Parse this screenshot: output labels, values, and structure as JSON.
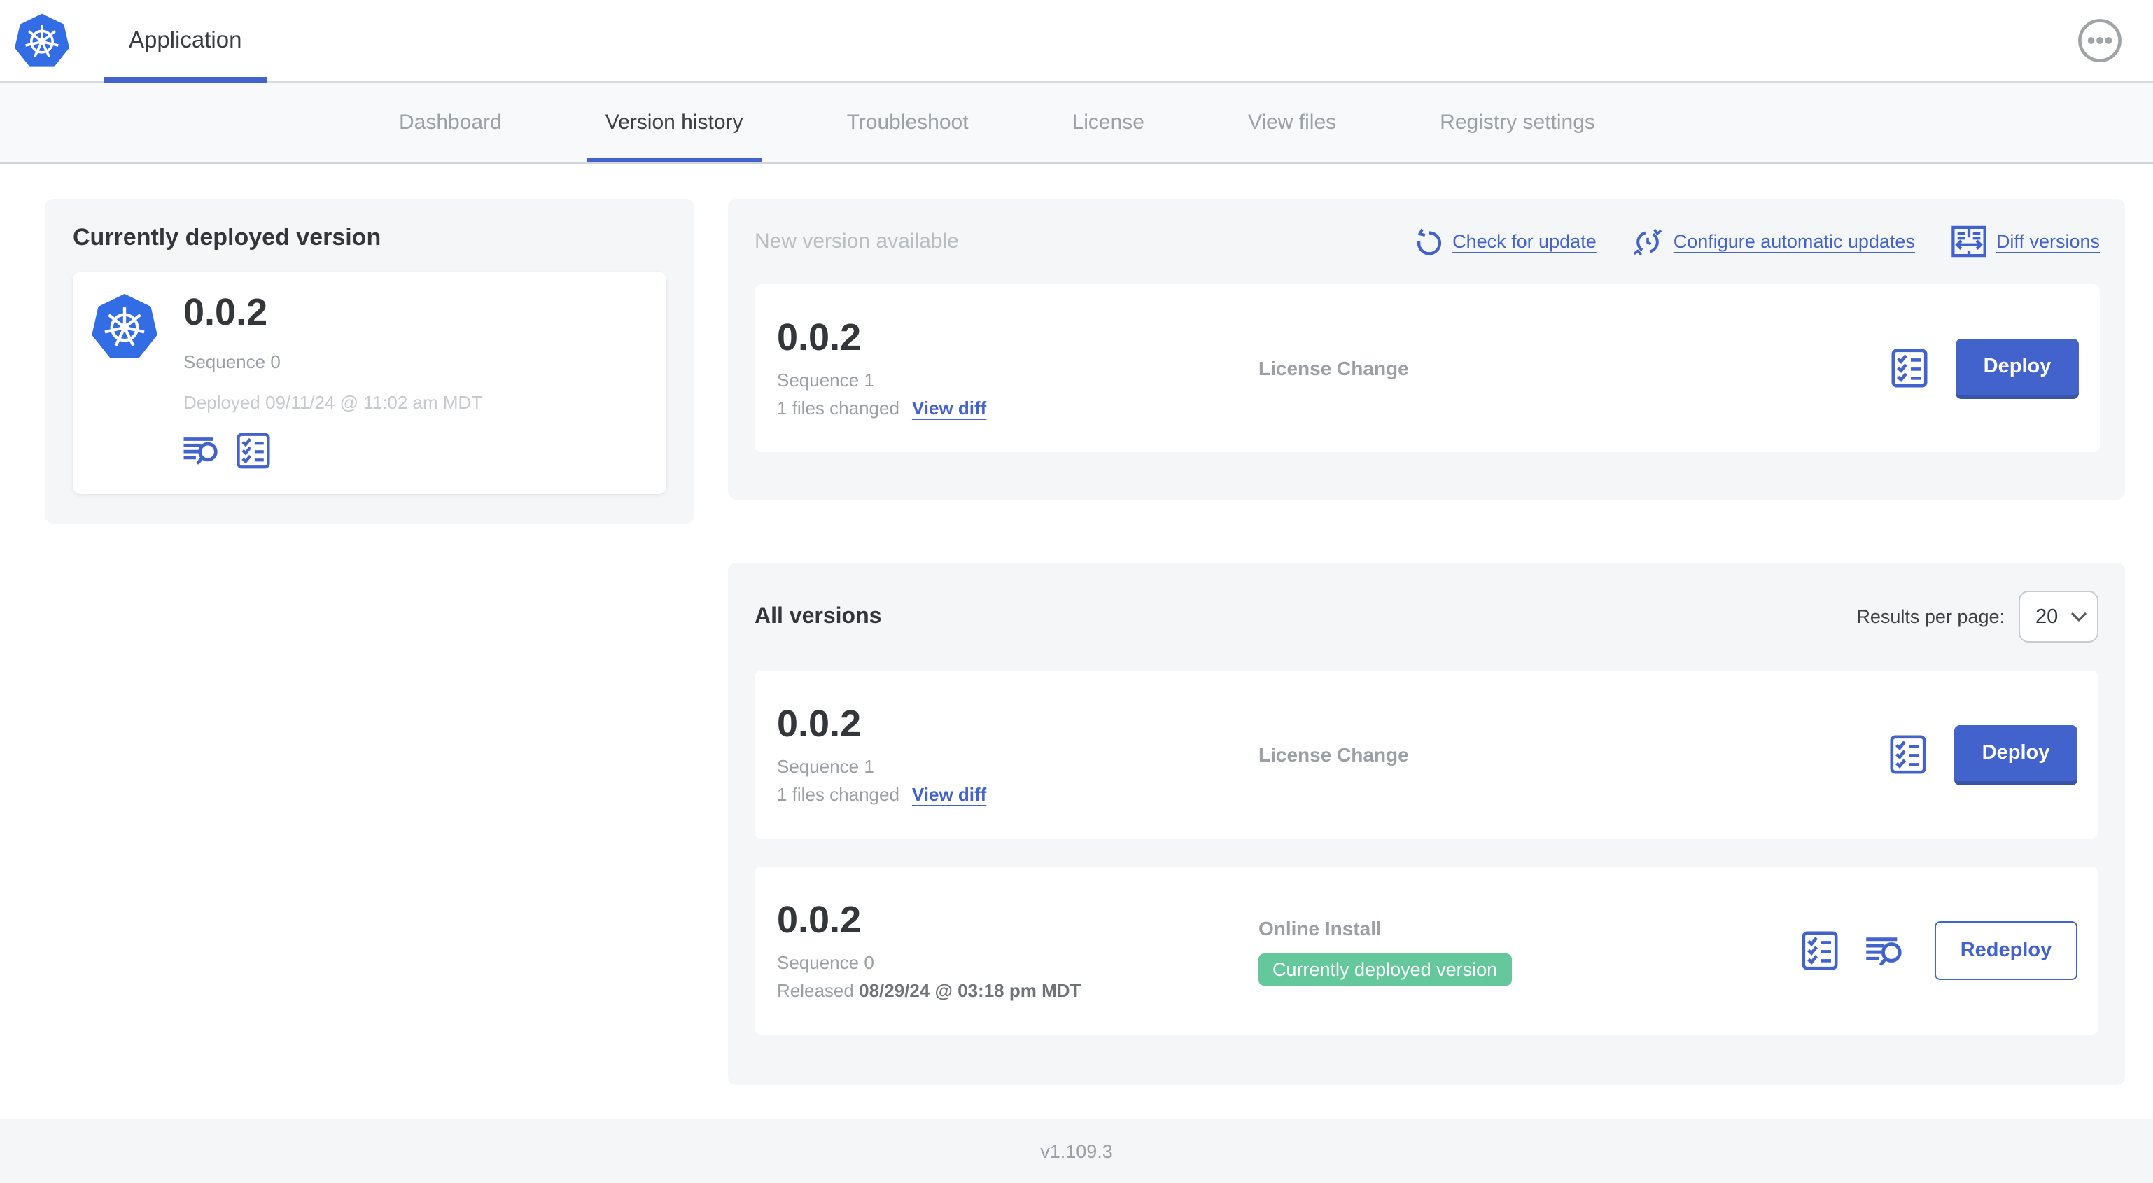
{
  "colors": {
    "accent": "#4263cb",
    "badge_green": "#65c89c",
    "k8s_blue": "#326de6"
  },
  "header": {
    "app_tab_label": "Application"
  },
  "nav": {
    "tabs": [
      "Dashboard",
      "Version history",
      "Troubleshoot",
      "License",
      "View files",
      "Registry settings"
    ],
    "active_tab": "Version history"
  },
  "deployed_panel": {
    "title": "Currently deployed version",
    "version": "0.0.2",
    "sequence": "Sequence 0",
    "deployed": "Deployed 09/11/24 @ 11:02 am MDT"
  },
  "new_version_panel": {
    "title": "New version available",
    "check_link": "Check for update",
    "configure_link": "Configure automatic updates",
    "diff_link": "Diff versions",
    "card": {
      "version": "0.0.2",
      "sequence": "Sequence 1",
      "files_changed": "1 files changed",
      "view_diff": "View diff",
      "source": "License Change",
      "deploy_button": "Deploy"
    }
  },
  "all_versions_panel": {
    "title": "All versions",
    "results_label": "Results per page:",
    "results_value": "20",
    "rows": [
      {
        "version": "0.0.2",
        "sequence": "Sequence 1",
        "files_changed": "1 files changed",
        "view_diff": "View diff",
        "source": "License Change",
        "action_button": "Deploy"
      },
      {
        "version": "0.0.2",
        "sequence": "Sequence 0",
        "released_label": "Released",
        "released_date": "08/29/24 @ 03:18 pm MDT",
        "source": "Online Install",
        "badge": "Currently deployed version",
        "action_button": "Redeploy"
      }
    ]
  },
  "footer": {
    "app_version": "v1.109.3"
  }
}
